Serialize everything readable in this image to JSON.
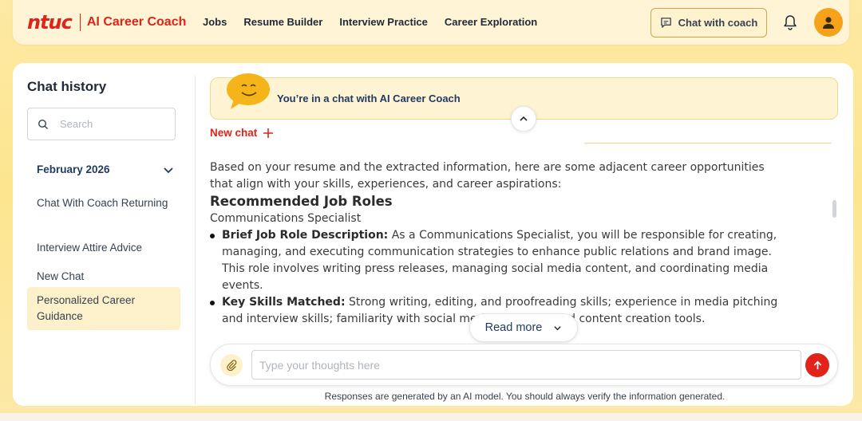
{
  "header": {
    "logo_mark": "ntuc",
    "logo_text": "AI Career Coach",
    "nav": [
      {
        "label": "Jobs"
      },
      {
        "label": "Resume Builder"
      },
      {
        "label": "Interview Practice"
      },
      {
        "label": "Career Exploration"
      }
    ],
    "chat_coach_label": "Chat with coach",
    "icons": {
      "chat": "chat-icon",
      "notifications": "bell-icon",
      "profile": "user-icon"
    }
  },
  "sidebar": {
    "title": "Chat history",
    "search_placeholder": "Search",
    "month": "February 2026",
    "items": [
      {
        "label": "Chat With Coach Returning",
        "active": false
      },
      {
        "label": "Interview Attire Advice",
        "active": false
      },
      {
        "label": "New Chat",
        "active": false
      },
      {
        "label": "Personalized Career Guidance",
        "active": true
      }
    ]
  },
  "chat": {
    "banner_text": "You’re in a chat with AI Career Coach",
    "new_chat_label": "New chat",
    "intro": "Based on your resume and the extracted information, here are some adjacent career opportunities that align with your skills, experiences, and career aspirations:",
    "section_heading": "Recommended Job Roles",
    "role_title": "Communications Specialist",
    "bullets": [
      {
        "label": "Brief Job Role Description:",
        "text": "As a Communications Specialist, you will be responsible for creating, managing, and executing communication strategies to enhance public relations and brand image. This role involves writing press releases, managing social media content, and coordinating media events."
      },
      {
        "label": "Key Skills Matched:",
        "text": "Strong writing, editing, and proofreading skills; experience in media pitching and interview skills; familiarity with social media platforms and content creation tools."
      }
    ],
    "read_more_label": "Read more",
    "input_placeholder": "Type your thoughts here",
    "disclaimer": "Responses are generated by an AI model. You should always verify the information generated."
  },
  "colors": {
    "brand_red": "#e2231a",
    "accent_yellow": "#fde58f",
    "avatar": "#f4a31b",
    "navy": "#1e3a5f"
  }
}
